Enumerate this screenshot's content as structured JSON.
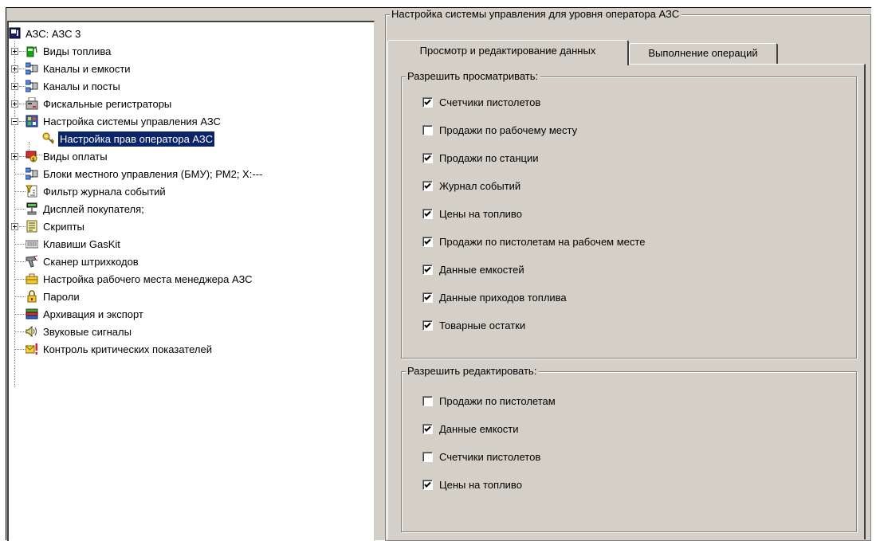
{
  "tree": {
    "items": [
      {
        "label": "АЗС: АЗС 3",
        "icon": "station-icon"
      },
      {
        "label": "Виды топлива",
        "icon": "fuel-pump-icon"
      },
      {
        "label": "Каналы и емкости",
        "icon": "network-icon"
      },
      {
        "label": "Каналы и посты",
        "icon": "network-icon"
      },
      {
        "label": "Фискальные регистраторы",
        "icon": "cash-register-icon"
      },
      {
        "label": "Настройка системы управления АЗС",
        "icon": "control-panel-icon"
      },
      {
        "label": "Настройка прав оператора АЗС",
        "icon": "key-icon"
      },
      {
        "label": "Виды оплаты",
        "icon": "payment-icon"
      },
      {
        "label": "Блоки местного управления (БМУ);  РМ2;  Х:---",
        "icon": "network-icon"
      },
      {
        "label": "Фильтр журнала событий",
        "icon": "filter-icon"
      },
      {
        "label": "Дисплей покупателя;",
        "icon": "display-icon"
      },
      {
        "label": "Скрипты",
        "icon": "script-icon"
      },
      {
        "label": "Клавиши GasKit",
        "icon": "keyboard-icon"
      },
      {
        "label": "Сканер штрихкодов",
        "icon": "barcode-scanner-icon"
      },
      {
        "label": "Настройка рабочего места менеджера АЗС",
        "icon": "briefcase-icon"
      },
      {
        "label": "Пароли",
        "icon": "lock-icon"
      },
      {
        "label": "Архивация и экспорт",
        "icon": "archive-icon"
      },
      {
        "label": "Звуковые сигналы",
        "icon": "speaker-icon"
      },
      {
        "label": "Контроль критических показателей",
        "icon": "alert-mail-icon"
      }
    ]
  },
  "panel": {
    "title": "Настройка системы управления для уровня оператора АЗС",
    "tabs": [
      {
        "label": "Просмотр и редактирование данных"
      },
      {
        "label": "Выполнение операций"
      }
    ],
    "view_group": {
      "label": "Разрешить просматривать:",
      "items": [
        {
          "label": "Счетчики пистолетов",
          "checked": true
        },
        {
          "label": "Продажи по рабочему месту",
          "checked": false
        },
        {
          "label": "Продажи по станции",
          "checked": true
        },
        {
          "label": "Журнал событий",
          "checked": true
        },
        {
          "label": "Цены на топливо",
          "checked": true
        },
        {
          "label": "Продажи по пистолетам на рабочем месте",
          "checked": true
        },
        {
          "label": "Данные емкостей",
          "checked": true
        },
        {
          "label": "Данные приходов топлива",
          "checked": true
        },
        {
          "label": "Товарные остатки",
          "checked": true
        }
      ]
    },
    "edit_group": {
      "label": "Разрешить редактировать:",
      "items": [
        {
          "label": "Продажи по пистолетам",
          "checked": false
        },
        {
          "label": "Данные емкости",
          "checked": true
        },
        {
          "label": "Счетчики пистолетов",
          "checked": false
        },
        {
          "label": "Цены на топливо",
          "checked": true
        }
      ]
    }
  },
  "colors": {
    "selection": "#0a246a",
    "face": "#d4d0c8"
  }
}
